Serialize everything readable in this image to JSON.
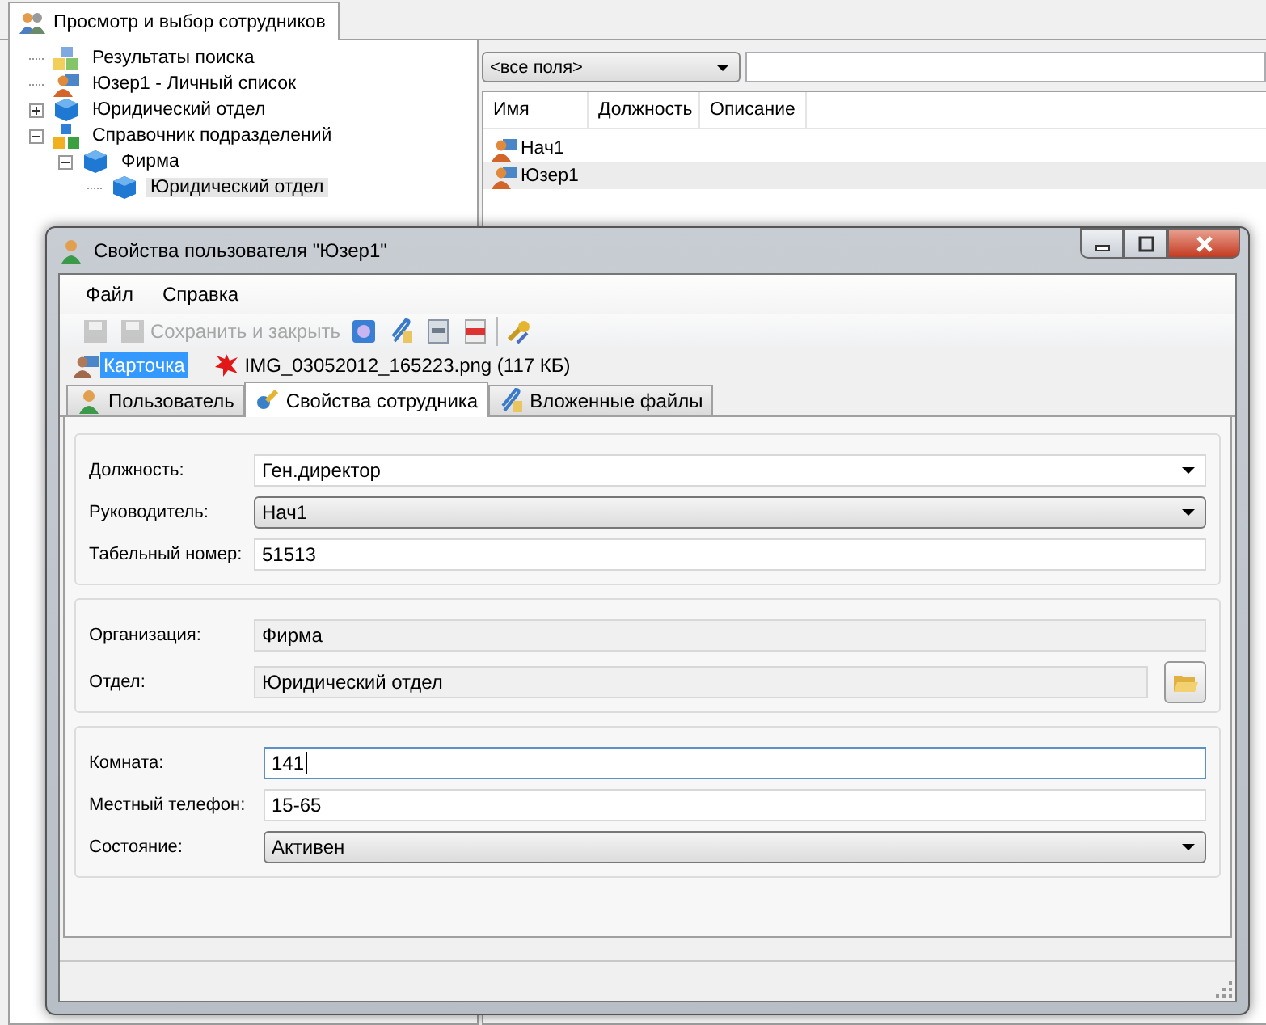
{
  "main_tab": {
    "label": "Просмотр и выбор сотрудников",
    "selected": true
  },
  "tree": [
    {
      "label": "Результаты поиска",
      "selected": false
    },
    {
      "label": "Юзер1 - Личный список",
      "selected": false
    },
    {
      "label": "Юридический отдел",
      "selected": false,
      "expanded": false
    },
    {
      "label": "Справочник подразделений",
      "selected": false,
      "expanded": true,
      "children": [
        {
          "label": "Фирма",
          "selected": false,
          "expanded": true,
          "children": [
            {
              "label": "Юридический отдел",
              "selected": true
            }
          ]
        }
      ]
    }
  ],
  "filter": {
    "field": "<все поля>"
  },
  "list": {
    "columns": [
      "Имя",
      "Должность",
      "Описание"
    ],
    "rows": [
      {
        "name": "Нач1",
        "selected": false
      },
      {
        "name": "Юзер1",
        "selected": true
      }
    ]
  },
  "dialog": {
    "title": "Свойства пользователя \"Юзер1\"",
    "menu": [
      "Файл",
      "Справка"
    ],
    "toolbar": [
      {
        "disabled": true
      },
      {
        "label": "Сохранить и закрыть",
        "disabled": true
      },
      {
        "disabled": false
      },
      {
        "disabled": false
      },
      {
        "disabled": false
      },
      {
        "disabled": false
      },
      {
        "disabled": false
      }
    ],
    "attachments": [
      {
        "name": "Карточка",
        "selected": true
      },
      {
        "name": "IMG_03052012_165223.png (117 КБ)",
        "selected": false
      }
    ],
    "tabs": [
      {
        "label": "Пользователь",
        "selected": false
      },
      {
        "label": "Свойства сотрудника",
        "selected": true
      },
      {
        "label": "Вложенные файлы",
        "selected": false
      }
    ],
    "groups": [
      {
        "rows": [
          {
            "label": "Должность:",
            "value": "Ген.директор",
            "kind": "combo",
            "focused": false
          },
          {
            "label": "Руководитель:",
            "value": "Нач1",
            "kind": "dropdown",
            "focused": false
          },
          {
            "label": "Табельный номер:",
            "value": "51513",
            "kind": "text",
            "focused": false
          }
        ]
      },
      {
        "rows": [
          {
            "label": "Организация:",
            "value": "Фирма",
            "kind": "readonly",
            "focused": false
          },
          {
            "label": "Отдел:",
            "value": "Юридический отдел",
            "kind": "picker",
            "focused": false
          }
        ]
      },
      {
        "rows": [
          {
            "label": "Комната:",
            "value": "141",
            "kind": "text",
            "focused": true
          },
          {
            "label": "Местный телефон:",
            "value": "15-65",
            "kind": "text",
            "focused": false
          },
          {
            "label": "Состояние:",
            "value": "Активен",
            "kind": "dropdown",
            "focused": false
          }
        ]
      }
    ]
  }
}
